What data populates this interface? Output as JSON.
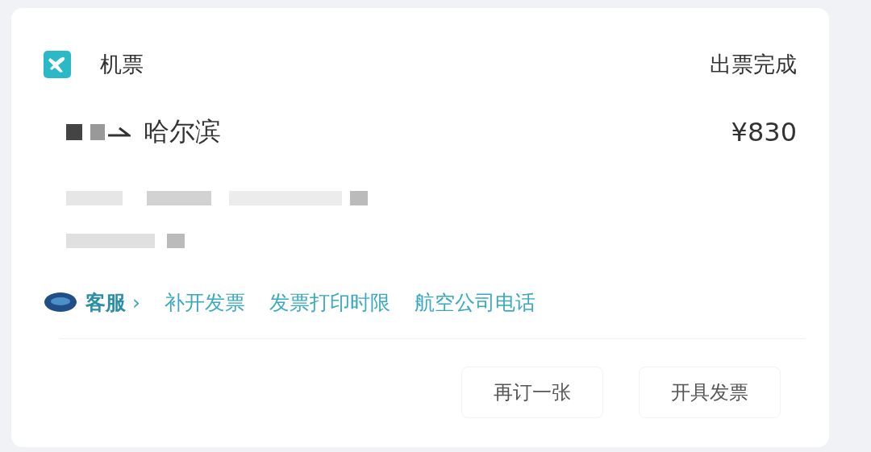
{
  "header": {
    "category": "机票",
    "status": "出票完成"
  },
  "route": {
    "destination": "哈尔滨",
    "price": "¥830"
  },
  "service": {
    "label": "客服",
    "chevron": "›"
  },
  "links": [
    "补开发票",
    "发票打印时限",
    "航空公司电话"
  ],
  "buttons": [
    "再订一张",
    "开具发票"
  ]
}
